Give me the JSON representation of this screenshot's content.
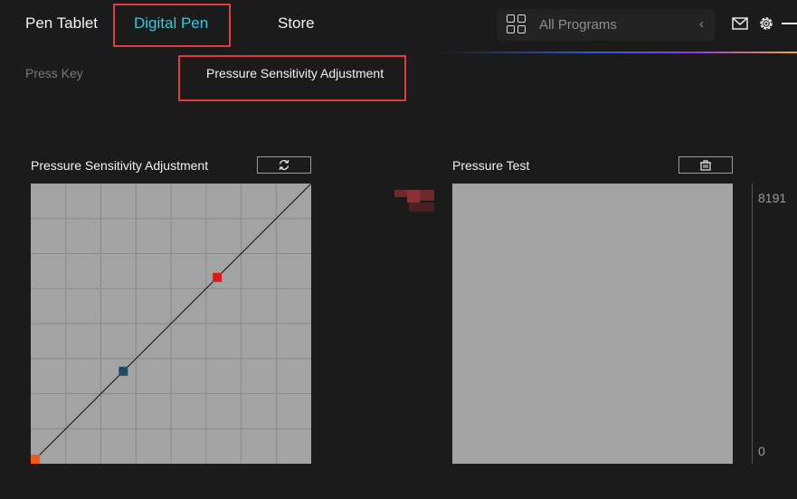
{
  "nav": {
    "tabs": [
      {
        "label": "Pen Tablet",
        "active": false
      },
      {
        "label": "Digital Pen",
        "active": true
      },
      {
        "label": "Store",
        "active": false
      }
    ],
    "active_color": "#38c6d9"
  },
  "program_selector": {
    "value": "All Programs",
    "icon": "grid-icon",
    "chevron": "‹"
  },
  "window_controls": [
    "mail-icon",
    "gear-icon",
    "minimize-icon"
  ],
  "sub_tabs": [
    {
      "label": "Press Key",
      "active": false
    },
    {
      "label": "Pressure Sensitivity Adjustment",
      "active": true
    }
  ],
  "pressure_adjustment": {
    "title": "Pressure Sensitivity Adjustment",
    "reset_icon": "refresh-icon",
    "curve": {
      "start": {
        "input": 0,
        "output": 0,
        "color": "#f05a14"
      },
      "control1": {
        "input": 0.33,
        "output": 0.33,
        "color": "#1f4a63"
      },
      "control2": {
        "input": 0.665,
        "output": 0.665,
        "color": "#e01818"
      },
      "end": {
        "input": 1,
        "output": 1
      }
    }
  },
  "pressure_test": {
    "title": "Pressure Test",
    "clear_icon": "trash-icon",
    "scale_max": "8191",
    "scale_min": "0",
    "current_pressure": 0
  },
  "colors": {
    "background": "#1b1b1b",
    "canvas": "#a3a3a3",
    "highlight": "#e03b3b"
  }
}
